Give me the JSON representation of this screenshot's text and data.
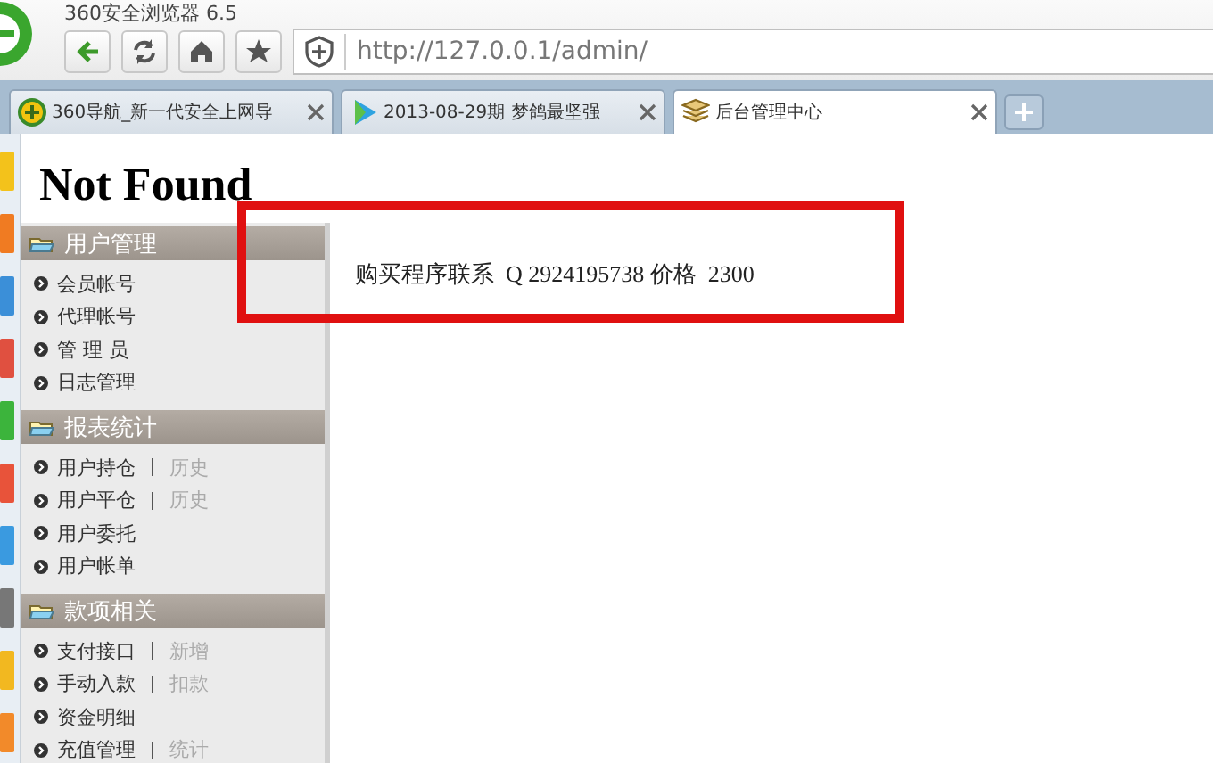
{
  "browser": {
    "title": "360安全浏览器 6.5",
    "address": "http://127.0.0.1/admin/",
    "tabs": [
      {
        "label": "360导航_新一代安全上网导",
        "selected": false,
        "kind": "nav"
      },
      {
        "label": "2013-08-29期 梦鸽最坚强",
        "selected": false,
        "kind": "video"
      },
      {
        "label": "后台管理中心",
        "selected": true,
        "kind": "admin"
      }
    ]
  },
  "page": {
    "heading": "Not Found",
    "menu": [
      {
        "title": "用户管理",
        "items": [
          {
            "label": "会员帐号"
          },
          {
            "label": "代理帐号"
          },
          {
            "label": "管 理 员"
          },
          {
            "label": "日志管理"
          }
        ]
      },
      {
        "title": "报表统计",
        "items": [
          {
            "label": "用户持仓",
            "extra": "历史"
          },
          {
            "label": "用户平仓",
            "extra": "历史"
          },
          {
            "label": "用户委托"
          },
          {
            "label": "用户帐单"
          }
        ]
      },
      {
        "title": "款项相关",
        "items": [
          {
            "label": "支付接口",
            "extra": "新增"
          },
          {
            "label": "手动入款",
            "extra": "扣款"
          },
          {
            "label": "资金明细"
          },
          {
            "label": "充值管理",
            "extra": "统计"
          }
        ]
      }
    ],
    "content": "购买程序联系  Q 2924195738 价格  2300"
  }
}
